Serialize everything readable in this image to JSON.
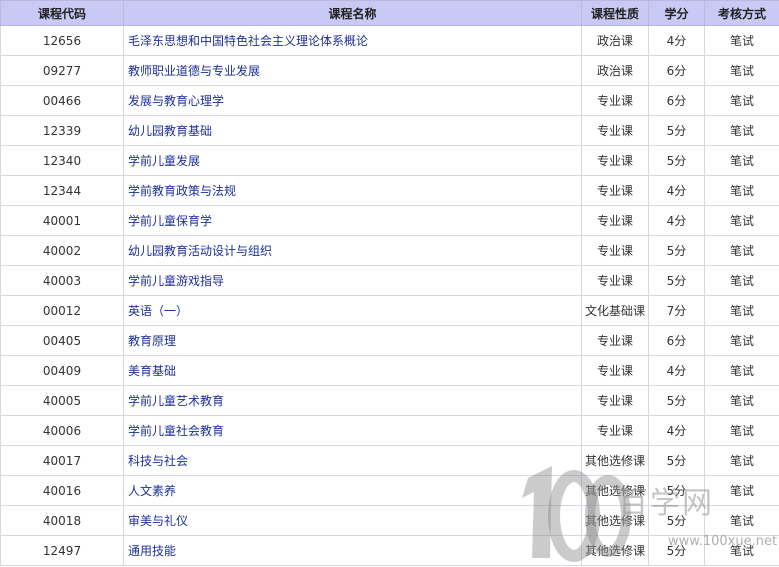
{
  "table": {
    "headers": [
      "课程代码",
      "课程名称",
      "课程性质",
      "学分",
      "考核方式"
    ],
    "rows": [
      {
        "code": "12656",
        "name": "毛泽东思想和中国特色社会主义理论体系概论",
        "type": "政治课",
        "credit": "4分",
        "exam": "笔试"
      },
      {
        "code": "09277",
        "name": "教师职业道德与专业发展",
        "type": "政治课",
        "credit": "6分",
        "exam": "笔试"
      },
      {
        "code": "00466",
        "name": "发展与教育心理学",
        "type": "专业课",
        "credit": "6分",
        "exam": "笔试"
      },
      {
        "code": "12339",
        "name": "幼儿园教育基础",
        "type": "专业课",
        "credit": "5分",
        "exam": "笔试"
      },
      {
        "code": "12340",
        "name": "学前儿童发展",
        "type": "专业课",
        "credit": "5分",
        "exam": "笔试"
      },
      {
        "code": "12344",
        "name": "学前教育政策与法规",
        "type": "专业课",
        "credit": "4分",
        "exam": "笔试"
      },
      {
        "code": "40001",
        "name": "学前儿童保育学",
        "type": "专业课",
        "credit": "4分",
        "exam": "笔试"
      },
      {
        "code": "40002",
        "name": "幼儿园教育活动设计与组织",
        "type": "专业课",
        "credit": "5分",
        "exam": "笔试"
      },
      {
        "code": "40003",
        "name": "学前儿童游戏指导",
        "type": "专业课",
        "credit": "5分",
        "exam": "笔试"
      },
      {
        "code": "00012",
        "name": "英语（一）",
        "type": "文化基础课",
        "credit": "7分",
        "exam": "笔试"
      },
      {
        "code": "00405",
        "name": "教育原理",
        "type": "专业课",
        "credit": "6分",
        "exam": "笔试"
      },
      {
        "code": "00409",
        "name": "美育基础",
        "type": "专业课",
        "credit": "4分",
        "exam": "笔试"
      },
      {
        "code": "40005",
        "name": "学前儿童艺术教育",
        "type": "专业课",
        "credit": "5分",
        "exam": "笔试"
      },
      {
        "code": "40006",
        "name": "学前儿童社会教育",
        "type": "专业课",
        "credit": "4分",
        "exam": "笔试"
      },
      {
        "code": "40017",
        "name": "科技与社会",
        "type": "其他选修课",
        "credit": "5分",
        "exam": "笔试"
      },
      {
        "code": "40016",
        "name": "人文素养",
        "type": "其他选修课",
        "credit": "5分",
        "exam": "笔试"
      },
      {
        "code": "40018",
        "name": "审美与礼仪",
        "type": "其他选修课",
        "credit": "5分",
        "exam": "笔试"
      },
      {
        "code": "12497",
        "name": "通用技能",
        "type": "其他选修课",
        "credit": "5分",
        "exam": "笔试"
      }
    ]
  },
  "watermark": {
    "logo_text": "百学网",
    "url": "www.100xue.net",
    "color": "#999999"
  },
  "colors": {
    "header_bg": "#c9c9f6",
    "link": "#1d2f9b"
  }
}
